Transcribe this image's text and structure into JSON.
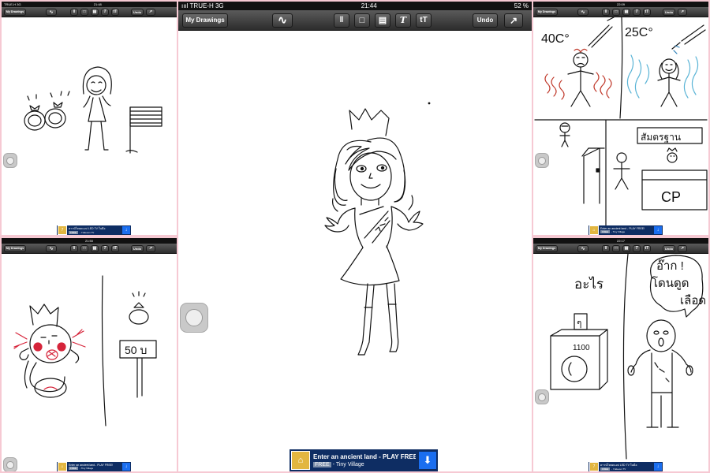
{
  "main": {
    "status": {
      "carrier": "ıııl TRUE-H  3G",
      "time": "21:44",
      "battery": "52 %"
    },
    "toolbar": {
      "my_drawings": "My Drawings",
      "undo": "Undo",
      "brush_icon": "wave-icon",
      "share_icon": "share-icon"
    },
    "ad": {
      "title": "Enter an ancient land - PLAY FREE!",
      "free": "FREE",
      "sub": "- Tiny Village"
    }
  },
  "top_left": {
    "status": {
      "carrier": "TRUE-H  3G",
      "time": "21:48",
      "battery": ""
    },
    "toolbar": {
      "my_drawings": "My Drawings",
      "undo": "Undo"
    },
    "ad": {
      "title": "ดาวน์โหลดแอป LED TV ในมือ",
      "free": "FREE",
      "sub": "- 7-Eleven TV"
    }
  },
  "top_right": {
    "status": {
      "carrier": "",
      "time": "22:09",
      "battery": ""
    },
    "toolbar": {
      "my_drawings": "My Drawings",
      "undo": "Undo"
    },
    "ad": {
      "title": "Enter an ancient land - PLAY FREE!",
      "free": "FREE",
      "sub": "- Tiny Village"
    },
    "drawing_text": {
      "temp_hot": "40C°",
      "temp_cool": "25C°",
      "sign": "สัมตรฐาน",
      "cp": "CP"
    }
  },
  "bottom_left": {
    "status": {
      "carrier": "",
      "time": "21:50",
      "battery": ""
    },
    "toolbar": {
      "my_drawings": "My Drawings",
      "undo": "Undo"
    },
    "ad": {
      "title": "Enter an ancient land - PLAY FREE!",
      "free": "FREE",
      "sub": "- Tiny Village"
    },
    "drawing_text": {
      "price": "50  บ"
    }
  },
  "bottom_right": {
    "status": {
      "carrier": "",
      "time": "22:17",
      "battery": ""
    },
    "toolbar": {
      "my_drawings": "My Drawings",
      "undo": "Undo"
    },
    "ad": {
      "title": "ดาวน์โหลดแอป LED TV ในมือ",
      "free": "FREE",
      "sub": "- 7-Eleven TV"
    },
    "drawing_text": {
      "what": "อะไร",
      "bubble1": "อ๊าก !",
      "bubble2": "โดนดูด",
      "bubble3": "เลือด",
      "box_num": "1100",
      "box_label": "ๆ"
    }
  }
}
